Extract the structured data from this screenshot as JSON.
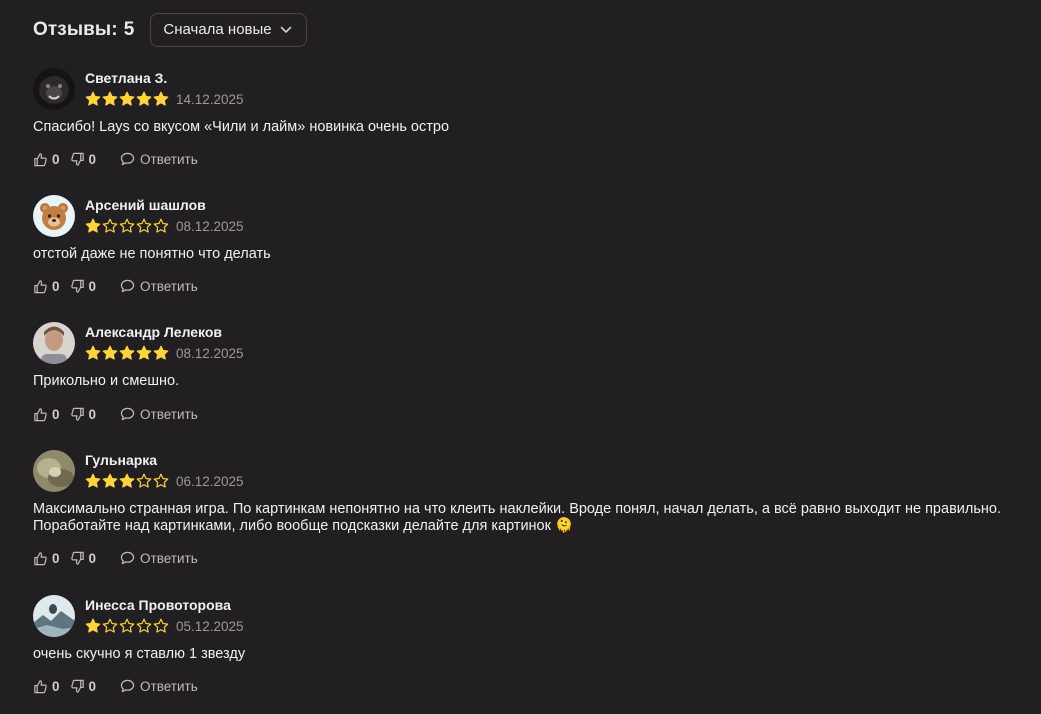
{
  "header": {
    "title": "Отзывы:",
    "count": "5",
    "sort": {
      "selected": "Сначала новые"
    }
  },
  "colors": {
    "background": "#221f22",
    "star_filled": "#ffd43b",
    "star_empty_stroke": "#ffd43b",
    "text_secondary": "#9b979b"
  },
  "reviews": [
    {
      "author": "Светлана З.",
      "rating": 5,
      "date": "14.12.2025",
      "text": "Спасибо! Lays со вкусом «Чили и лайм» новинка очень остро",
      "likes": "0",
      "dislikes": "0",
      "reply_label": "Ответить",
      "avatar_icon": "dark-animal-photo"
    },
    {
      "author": "Арсений шашлов",
      "rating": 1,
      "date": "08.12.2025",
      "text": "отстой даже не понятно что делать",
      "likes": "0",
      "dislikes": "0",
      "reply_label": "Ответить",
      "avatar_icon": "bear-face-emoji"
    },
    {
      "author": "Александр Лелеков",
      "rating": 5,
      "date": "08.12.2025",
      "text": "Прикольно и смешно.",
      "likes": "0",
      "dislikes": "0",
      "reply_label": "Ответить",
      "avatar_icon": "person-photo"
    },
    {
      "author": "Гульнарка",
      "rating": 3,
      "date": "06.12.2025",
      "text": "Максимально странная игра. По картинкам непонятно на что клеить наклейки. Вроде понял, начал делать, а всё равно выходит не правильно. Поработайте над картинками, либо вообще подсказки делайте для картинок 🫠",
      "likes": "0",
      "dislikes": "0",
      "reply_label": "Ответить",
      "avatar_icon": "blurry-photo"
    },
    {
      "author": "Инесса Провоторова",
      "rating": 1,
      "date": "05.12.2025",
      "text": "очень скучно я ставлю 1 звезду",
      "likes": "0",
      "dislikes": "0",
      "reply_label": "Ответить",
      "avatar_icon": "landscape-photo"
    }
  ]
}
